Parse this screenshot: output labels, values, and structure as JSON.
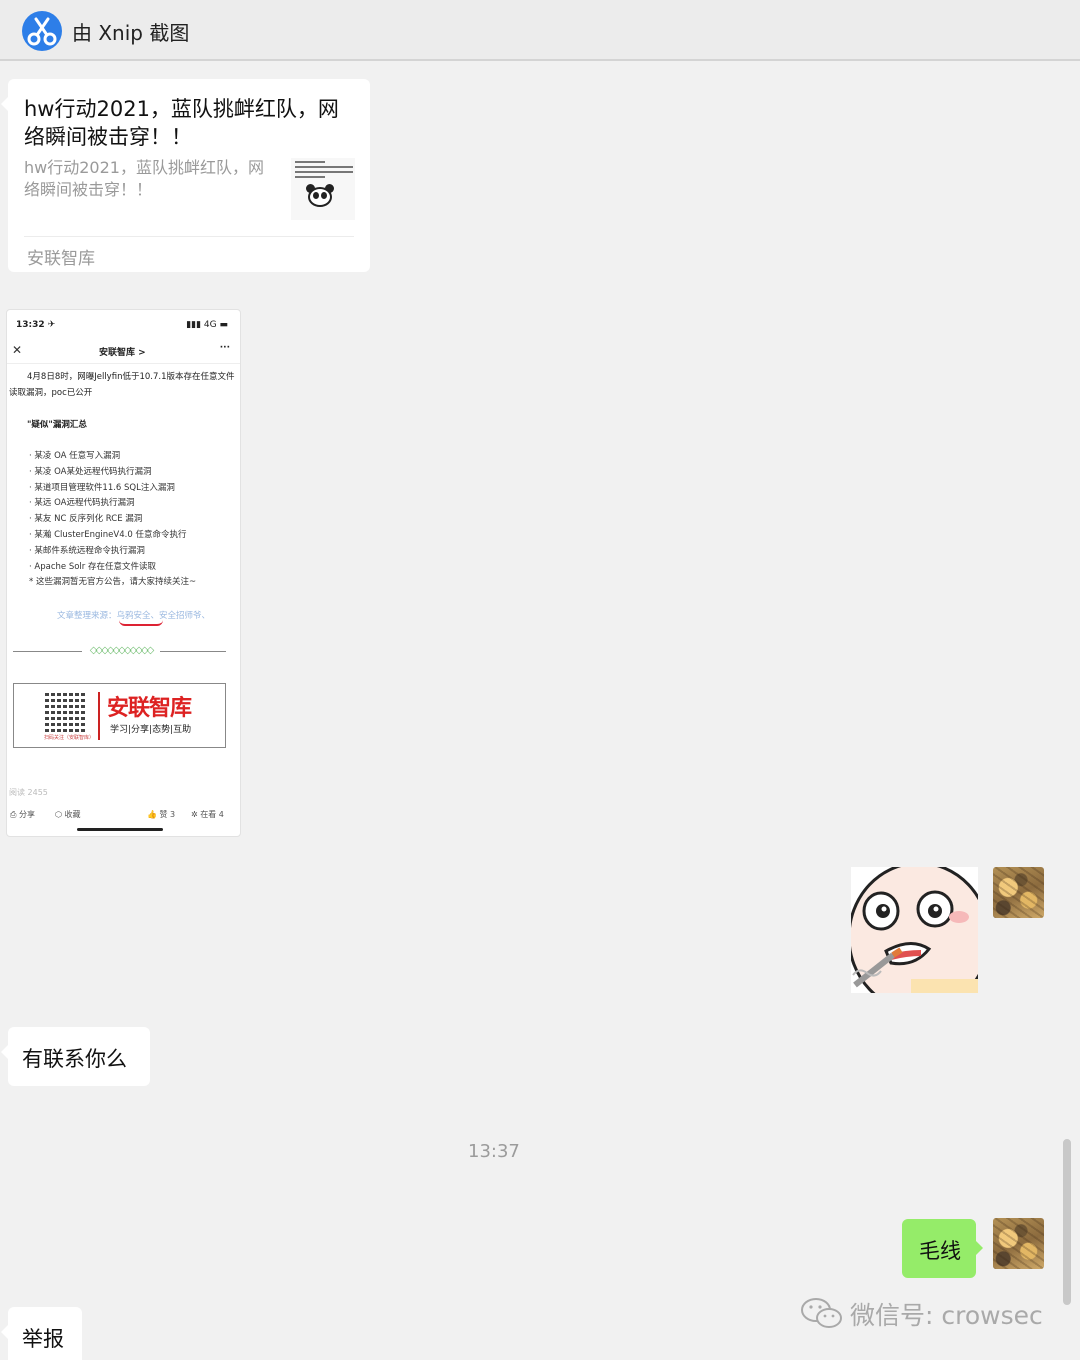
{
  "window": {
    "title": "由 Xnip 截图",
    "app_icon": "scissors-icon"
  },
  "messages": {
    "article": {
      "title": "hw行动2021，蓝队挑衅红队，网络瞬间被击穿！！",
      "description": "hw行动2021，蓝队挑衅红队，网络瞬间被击穿！！",
      "source": "安联智库"
    },
    "screenshot": {
      "status_time": "13:32 ✈",
      "status_right": "4G",
      "nav_close": "✕",
      "nav_title": "安联智库 >",
      "nav_more": "···",
      "intro": "4月8日8时，网曝Jellyfin低于10.7.1版本存在任意文件读取漏洞，poc已公开",
      "section_title": "\"疑似\"漏洞汇总",
      "items": [
        "· 某凌 OA 任意写入漏洞",
        "· 某凌 OA某处远程代码执行漏洞",
        "· 某道项目管理软件11.6 SQL注入漏洞",
        "· 某远 OA远程代码执行漏洞",
        "· 某友 NC 反序列化 RCE 漏洞",
        "· 某瀚 ClusterEngineV4.0 任意命令执行",
        "· 某邮件系统远程命令执行漏洞",
        "· Apache Solr 存在任意文件读取",
        "* 这些漏洞暂无官方公告，请大家持续关注~"
      ],
      "source_line": "文章整理来源：乌鸦安全、安全招师爷、",
      "brand_name": "安联智库",
      "brand_tagline": "学习|分享|态势|互助",
      "qr_caption": "扫码关注（安联智库）",
      "reads": "阅读 2455",
      "share": "分享",
      "collect": "收藏",
      "like": "赞 3",
      "wow": "在看 4"
    },
    "reply1": "有联系你么",
    "time_divider": "13:37",
    "reply_self": "毛线",
    "reply2": "举报"
  },
  "watermark": {
    "text": "微信号: crowsec",
    "icon": "wechat-icon"
  },
  "colors": {
    "bubble_self": "#95ec69",
    "bubble_other": "#ffffff",
    "background": "#f1f1f1"
  }
}
